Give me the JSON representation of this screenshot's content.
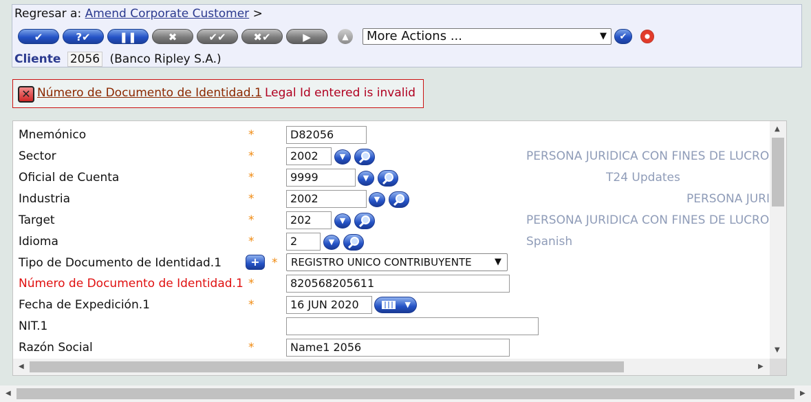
{
  "header": {
    "back_prefix": "Regresar a:",
    "back_link": "Amend Corporate Customer",
    "back_suffix": ">",
    "toolbar": {
      "buttons": [
        {
          "name": "commit",
          "glyph": "✔",
          "state": "enabled"
        },
        {
          "name": "validate",
          "glyph": "?✔",
          "state": "enabled"
        },
        {
          "name": "hold",
          "glyph": "❚❚",
          "state": "enabled"
        },
        {
          "name": "delete",
          "glyph": "✖",
          "state": "disabled"
        },
        {
          "name": "authorise",
          "glyph": "✔✔",
          "state": "disabled"
        },
        {
          "name": "reverse",
          "glyph": "✖✔",
          "state": "disabled"
        },
        {
          "name": "next",
          "glyph": "▶",
          "state": "disabled"
        }
      ],
      "more_actions": "More Actions ...",
      "go_glyph": "✔"
    },
    "cliente_label": "Cliente",
    "cliente_id": "2056",
    "cliente_name": "(Banco Ripley S.A.)"
  },
  "error": {
    "field_link": "Número de Documento de Identidad.1",
    "message": "Legal Id entered is invalid"
  },
  "form": {
    "rows": [
      {
        "label": "Mnemónico",
        "value": "D82056",
        "desc": ""
      },
      {
        "label": "Sector",
        "value": "2002",
        "desc": "PERSONA JURIDICA CON FINES DE LUCRO"
      },
      {
        "label": "Oficial de Cuenta",
        "value": "9999",
        "desc": "T24 Updates"
      },
      {
        "label": "Industria",
        "value": "2002",
        "desc": "PERSONA JURI"
      },
      {
        "label": "Target",
        "value": "202",
        "desc": "PERSONA JURIDICA CON FINES DE LUCRO"
      },
      {
        "label": "Idioma",
        "value": "2",
        "desc": "Spanish"
      },
      {
        "label": "Tipo de Documento de Identidad.1",
        "value": "REGISTRO UNICO CONTRIBUYENTE",
        "desc": ""
      },
      {
        "label": "Número de Documento de Identidad.1",
        "value": "820568205611",
        "desc": ""
      },
      {
        "label": "Fecha de Expedición.1",
        "value": "16 JUN 2020",
        "desc": ""
      },
      {
        "label": "NIT.1",
        "value": "",
        "desc": ""
      },
      {
        "label": "Razón Social",
        "value": "Name1 2056",
        "desc": ""
      }
    ],
    "required_mark": "*"
  },
  "colors": {
    "error": "#e01010",
    "accent": "#2553c6",
    "description": "#8f9cb8",
    "required": "#f08a10"
  }
}
